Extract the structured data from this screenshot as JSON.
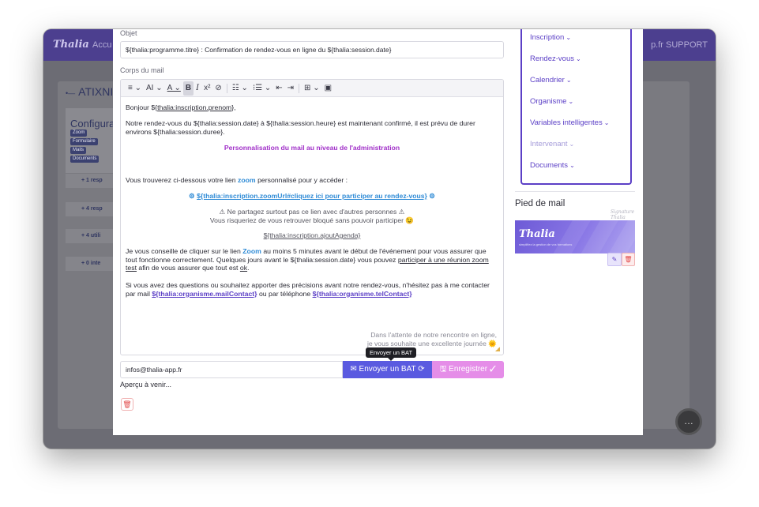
{
  "app": {
    "logo": "Thalia",
    "nav_item": "Accu",
    "support": "p.fr SUPPORT",
    "title": "ATIXNI",
    "config_title": "Configura",
    "tags": [
      "Zoom",
      "Formulaire",
      "Mails",
      "Documents"
    ],
    "resp_rows": [
      "+ 1 resp",
      "+ 4 resp",
      "+ 4 utili",
      "+ 0 inte"
    ]
  },
  "modal": {
    "objet_label": "Objet",
    "objet_value": "${thalia:programme.titre} : Confirmation de rendez-vous en ligne du ${thalia:session.date}",
    "corps_label": "Corps du mail",
    "toolbar": [
      "≡ ⌄",
      "AI ⌄",
      "A ⌄",
      "B",
      "I",
      "x²",
      "⊘",
      "☷ ⌄",
      "⁝☰ ⌄",
      "⇤",
      "⇥",
      "⊞ ⌄",
      "▣"
    ],
    "body": {
      "greeting_pre": "Bonjour ${",
      "greeting_link": "thalia:inscription.prenom",
      "greeting_post": "},",
      "para1": "Notre rendez-vous du ${thalia:session.date} à ${thalia:session.heure} est maintenant confirmé, il est prévu de durer environs ${thalia:session.duree}.",
      "heading": "Personnalisation du mail au niveau de l'administration",
      "zoom_pre": "Vous trouverez ci-dessous votre lien ",
      "zoom_word": "zoom",
      "zoom_post": " personnalisé pour y accéder :",
      "link_icon": "⚙",
      "link_text": "${thalia:inscription.zoomUrl#cliquez ici pour participer au rendez-vous}",
      "warn1": "⚠ Ne partagez surtout pas ce lien avec d'autres personnes ⚠",
      "warn2": "Vous risqueriez de vous retrouver bloqué sans pouvoir participer 😉",
      "agenda": "${thalia:inscription.ajoutAgenda}",
      "para2_a": "Je vous conseille de cliquer sur le lien ",
      "para2_zoom": "Zoom",
      "para2_b": " au moins 5 minutes avant le début de l'événement pour vous assurer que tout fonctionne correctement. Quelques jours avant le ${thalia:session.date} vous pouvez ",
      "para2_link": "participer à une réunion zoom test",
      "para2_c": " afin de vous assurer que tout est ",
      "para2_ok": "ok",
      "para2_d": ".",
      "para3_a": "Si vous avez des questions ou souhaitez apporter des précisions avant notre rendez-vous, n'hésitez pas à me contacter par mail ",
      "para3_mail": "${thalia:organisme.mailContact}",
      "para3_b": " ou par téléphone ",
      "para3_tel": "${thalia:organisme.telContact}",
      "sign1": "Dans l'attente de notre rencontre en ligne,",
      "sign2": "je vous souhaite une excellente journée 🌞"
    },
    "bat_email": "infos@thalia-app.fr",
    "bat_button": "✉ Envoyer un BAT ⟳",
    "save_button": "🖫 Enregistrer ✓",
    "tooltip": "Envoyer un BAT",
    "apercu": "Aperçu à venir...",
    "trash_icon": "🗑"
  },
  "variables": {
    "items": [
      {
        "label": "Inscription",
        "muted": false
      },
      {
        "label": "Rendez-vous",
        "muted": false
      },
      {
        "label": "Calendrier",
        "muted": false
      },
      {
        "label": "Organisme",
        "muted": false
      },
      {
        "label": "Variables intelligentes",
        "muted": false
      },
      {
        "label": "Intervenant",
        "muted": true
      },
      {
        "label": "Documents",
        "muted": false
      }
    ],
    "chevron": "⌄"
  },
  "footer": {
    "title": "Pied de mail",
    "signature": "Signature Thalia",
    "banner_logo": "Thalia",
    "banner_tag": "simplifiez la gestion de vos formations",
    "edit_icon": "✎",
    "delete_icon": "🗑"
  },
  "colors": {
    "accent": "#5b3fc6",
    "bat_button": "#5a5ae0",
    "save_button": "#e58de8",
    "heading_purple": "#a02fc8",
    "zoom_blue": "#2f8bd6"
  }
}
